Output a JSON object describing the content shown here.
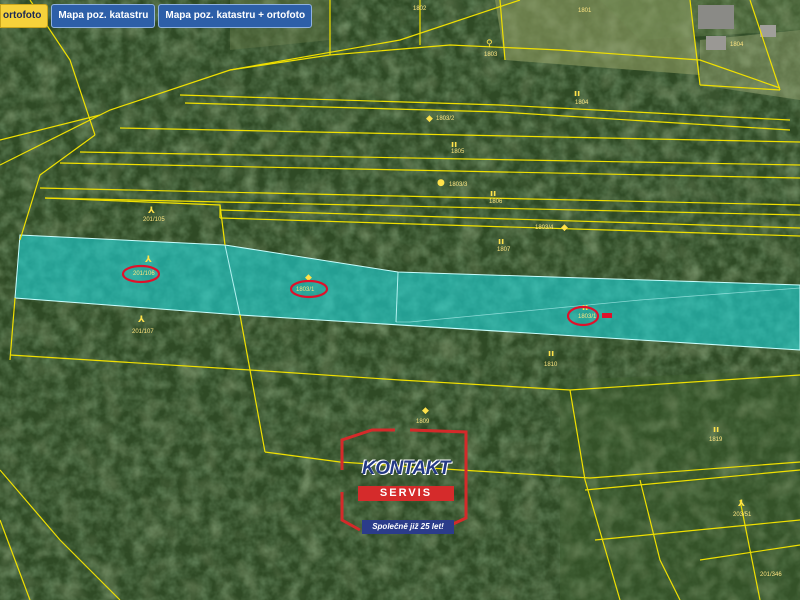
{
  "toolbar": {
    "buttons": [
      {
        "label": "ortofoto",
        "active": true
      },
      {
        "label": "Mapa poz. katastru",
        "active": false
      },
      {
        "label": "Mapa poz. katastru + ortofoto",
        "active": false
      }
    ]
  },
  "map": {
    "colors": {
      "parcel_border": "#f0e000",
      "highlight_fill": "#1fd3d6",
      "highlight_border": "#c8ffff",
      "marker_ellipse": "#e0102a"
    },
    "parcel_labels": [
      "1802",
      "1801",
      "1803",
      "1804",
      "1803/2",
      "1805",
      "1803/3",
      "1806",
      "1803/4",
      "1807",
      "201/105",
      "201/106",
      "1803/1",
      "201/107",
      "201/108",
      "1810",
      "1809",
      "1811",
      "1816",
      "1819",
      "203/51",
      "201/346"
    ],
    "marked_parcels": [
      "201/106",
      "1802/2",
      "1803/1"
    ]
  },
  "logo": {
    "title": "KONTAKT",
    "subtitle": "SERVIS",
    "tagline": "Společně již 25 let!"
  }
}
